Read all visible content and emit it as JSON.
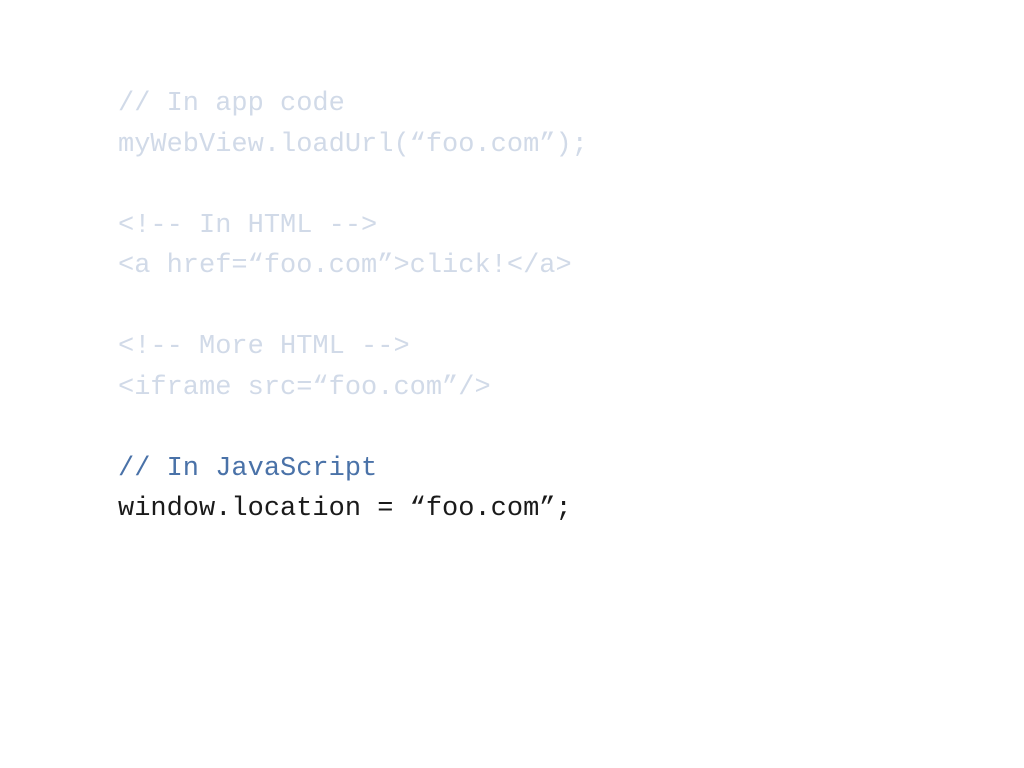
{
  "lines": {
    "l1": "// In app code",
    "l2": "myWebView.loadUrl(“foo.com”);",
    "l3": "<!-- In HTML -->",
    "l4": "<a href=“foo.com”>click!</a>",
    "l5": "<!-- More HTML -->",
    "l6": "<iframe src=“foo.com”/>",
    "l7": "// In JavaScript",
    "l8": "window.location = “foo.com”;"
  }
}
